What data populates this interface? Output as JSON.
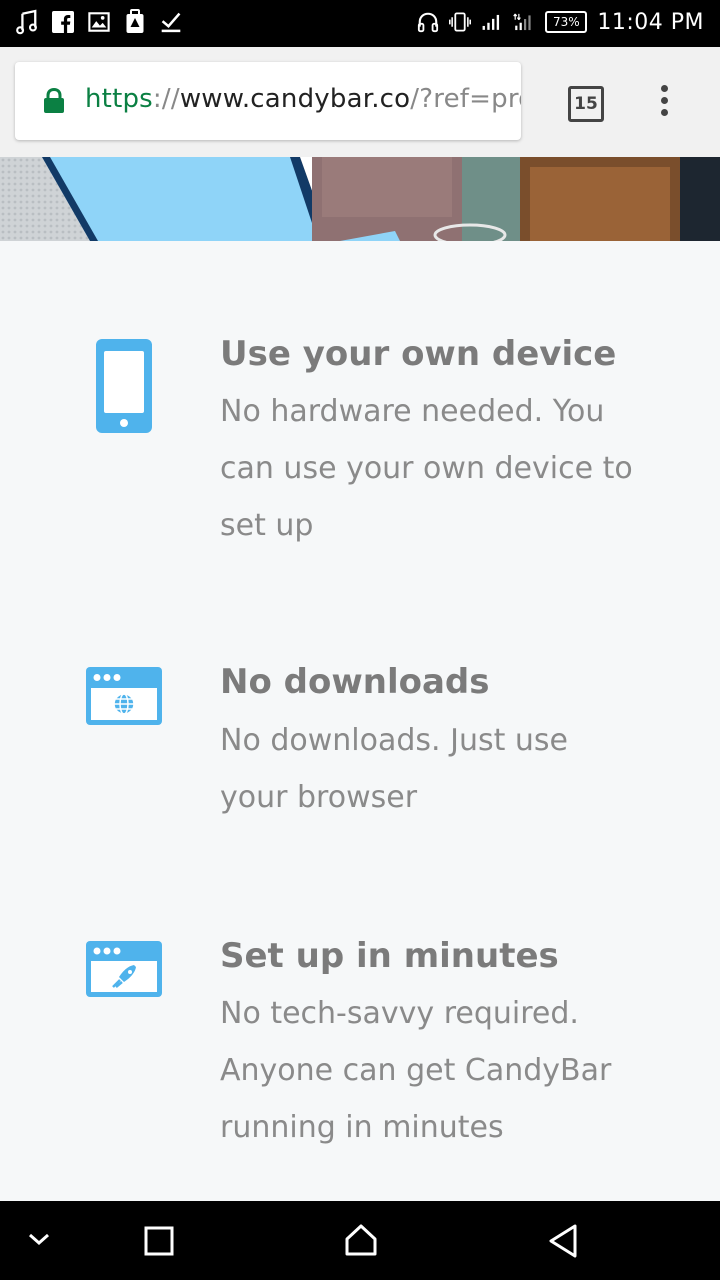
{
  "status_bar": {
    "battery": "73%",
    "time": "11:04 PM"
  },
  "browser": {
    "url_scheme": "https",
    "url_sep": "://",
    "url_host": "www.candybar.co",
    "url_path": "/?ref=pro",
    "tab_count": "15"
  },
  "features": [
    {
      "icon": "smartphone-icon",
      "title": "Use your own device",
      "description": "No hardware needed. You can use your own device to set up"
    },
    {
      "icon": "browser-globe-icon",
      "title": "No downloads",
      "description": "No downloads. Just use your browser"
    },
    {
      "icon": "browser-rocket-icon",
      "title": "Set up in minutes",
      "description": "No tech-savvy required. Anyone can get CandyBar running in minutes"
    }
  ],
  "colors": {
    "icon_blue": "#4fb3ec",
    "text_gray": "#7b7b7b",
    "secure_green": "#0b8043"
  }
}
